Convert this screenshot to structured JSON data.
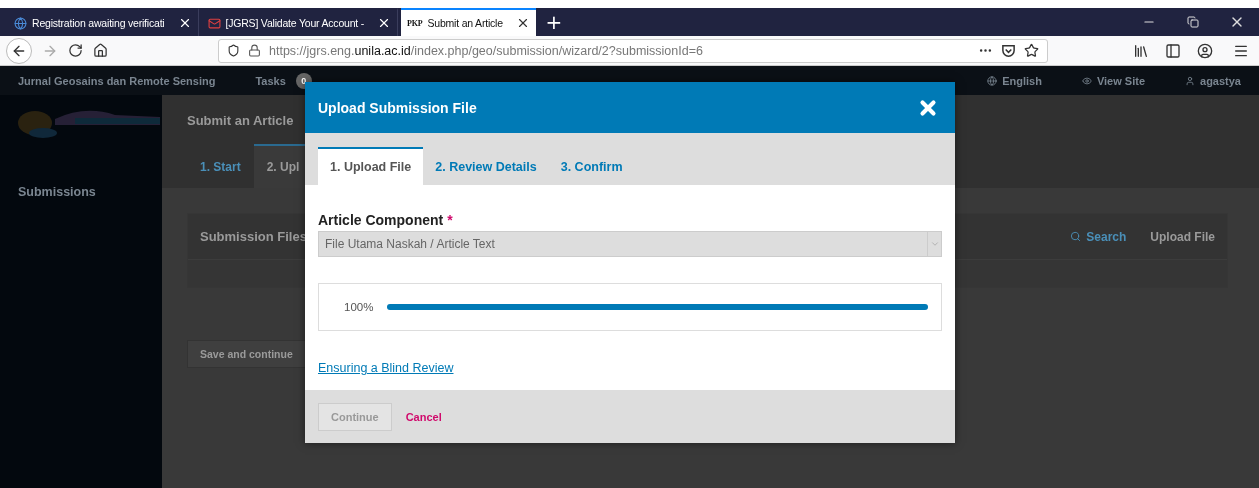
{
  "browser": {
    "tabs": [
      {
        "title": "Registration awaiting verificati",
        "kind": "globe",
        "selected": false
      },
      {
        "title": "[JGRS] Validate Your Account -",
        "kind": "mail",
        "selected": false
      },
      {
        "title": "Submit an Article",
        "kind": "text",
        "favicon_text": "PKP",
        "selected": true
      }
    ],
    "new_tab": "+",
    "url": "https://jgrs.eng.**unila.ac.id**/index.php/geo/submission/wizard/2?submissionId=6"
  },
  "header": {
    "journal": "Jurnal Geosains dan Remote Sensing",
    "tasks": "Tasks",
    "tasks_count": "0",
    "language": "English",
    "view_site": "View Site",
    "user": "agastya"
  },
  "sidebar": {
    "items": [
      "Submissions"
    ]
  },
  "page": {
    "title": "Submit an Article",
    "steps": [
      {
        "label": "1. Start",
        "selected": false
      },
      {
        "label": "2. Upl",
        "selected": true
      }
    ],
    "files_panel": {
      "title": "Submission Files",
      "search": "Search",
      "upload": "Upload File"
    },
    "save_button": "Save and continue"
  },
  "modal": {
    "title": "Upload Submission File",
    "tabs": [
      {
        "label": "1. Upload File",
        "selected": true
      },
      {
        "label": "2. Review Details",
        "selected": false
      },
      {
        "label": "3. Confirm",
        "selected": false
      }
    ],
    "field": {
      "label": "Article Component",
      "required_mark": "*",
      "value": "File Utama Naskah / Article Text"
    },
    "progress": {
      "reading": "100%",
      "level": 1
    },
    "link": "Ensuring a Blind Review",
    "buttons": [
      {
        "label": "Continue",
        "kind": "primary",
        "disabled": true
      },
      {
        "label": "Cancel",
        "kind": "cancel",
        "disabled": false
      }
    ]
  }
}
